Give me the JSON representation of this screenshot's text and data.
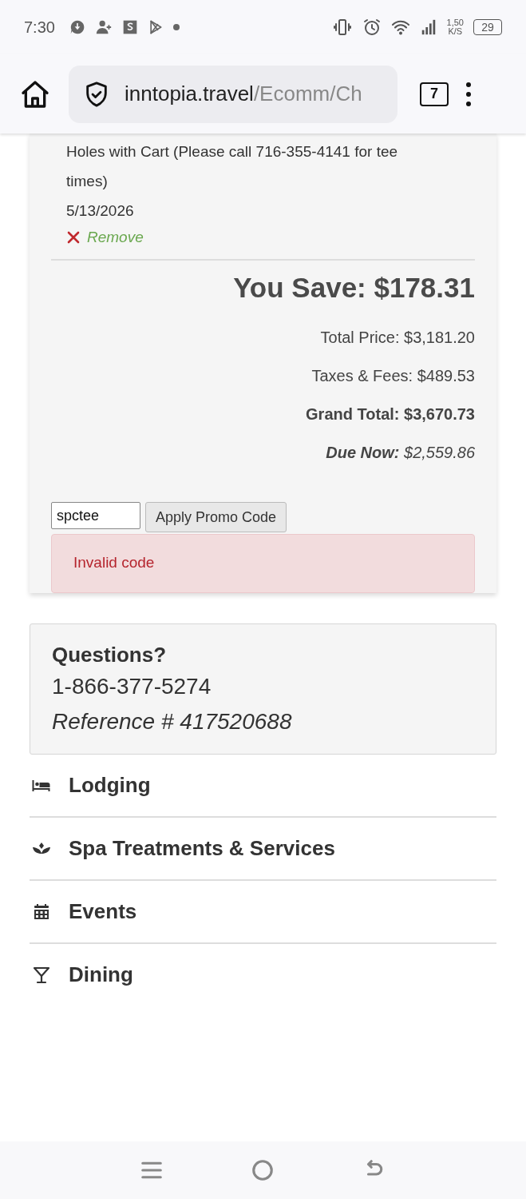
{
  "status_bar": {
    "time": "7:30",
    "net_speed": "1,50",
    "net_unit": "K/S",
    "battery": "29"
  },
  "browser": {
    "url_host": "inntopia.travel",
    "url_path": "/Ecomm/Ch",
    "tab_count": "7"
  },
  "cart_item": {
    "description": "Holes with Cart (Please call 716-355-4141 for tee times)",
    "date": "5/13/2026",
    "remove_label": "Remove"
  },
  "summary": {
    "you_save": "You Save: $178.31",
    "total_price": "Total Price: $3,181.20",
    "taxes_fees": "Taxes & Fees: $489.53",
    "grand_total": "Grand Total: $3,670.73",
    "due_now": "**Due Now:** $2,559.86"
  },
  "promo": {
    "value": "spctee",
    "button": "Apply Promo Code",
    "error": "Invalid code"
  },
  "questions": {
    "title": "Questions?",
    "phone": "1-866-377-5274",
    "reference": "Reference # 417520688"
  },
  "categories": [
    {
      "label": "Lodging",
      "kind": "bed"
    },
    {
      "label": "Spa Treatments & Services",
      "kind": "lotus"
    },
    {
      "label": "Events",
      "kind": "calendar"
    },
    {
      "label": "Dining",
      "kind": "glass"
    }
  ]
}
